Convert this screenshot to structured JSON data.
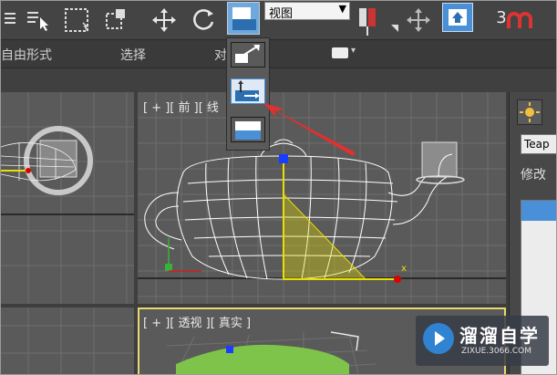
{
  "toolbar": {
    "icons": [
      "select-list-icon",
      "select-arrow-icon",
      "rect-select-icon",
      "window-crossing-icon",
      "move-icon",
      "rotate-icon",
      "scale-flyout-icon"
    ],
    "reference_dropdown": {
      "value": "视图"
    },
    "right_icons": [
      "pivot-icon",
      "manipulate-icon",
      "key-icon"
    ],
    "snap_label": "3"
  },
  "ribbon": {
    "tabs": [
      "自由形式",
      "选择",
      "对"
    ]
  },
  "flyout": {
    "options": [
      "select-and-scale-icon",
      "select-and-squash-icon",
      "select-and-nonuniform-scale-icon"
    ]
  },
  "viewports": {
    "front": {
      "label": "[ + ][ 前 ][ 线"
    },
    "perspective": {
      "label": "[ + ][ 透视 ][ 真实 ]"
    },
    "front_axis_label": "x"
  },
  "command_panel": {
    "object_name": "Teap",
    "modify_label": "修改"
  },
  "watermark": {
    "title": "溜溜自学",
    "url": "ZIXUE.3066.COM"
  },
  "colors": {
    "accent_blue": "#4a90d9",
    "selection_yellow": "#e8e000",
    "arrow_red": "#e03030"
  }
}
